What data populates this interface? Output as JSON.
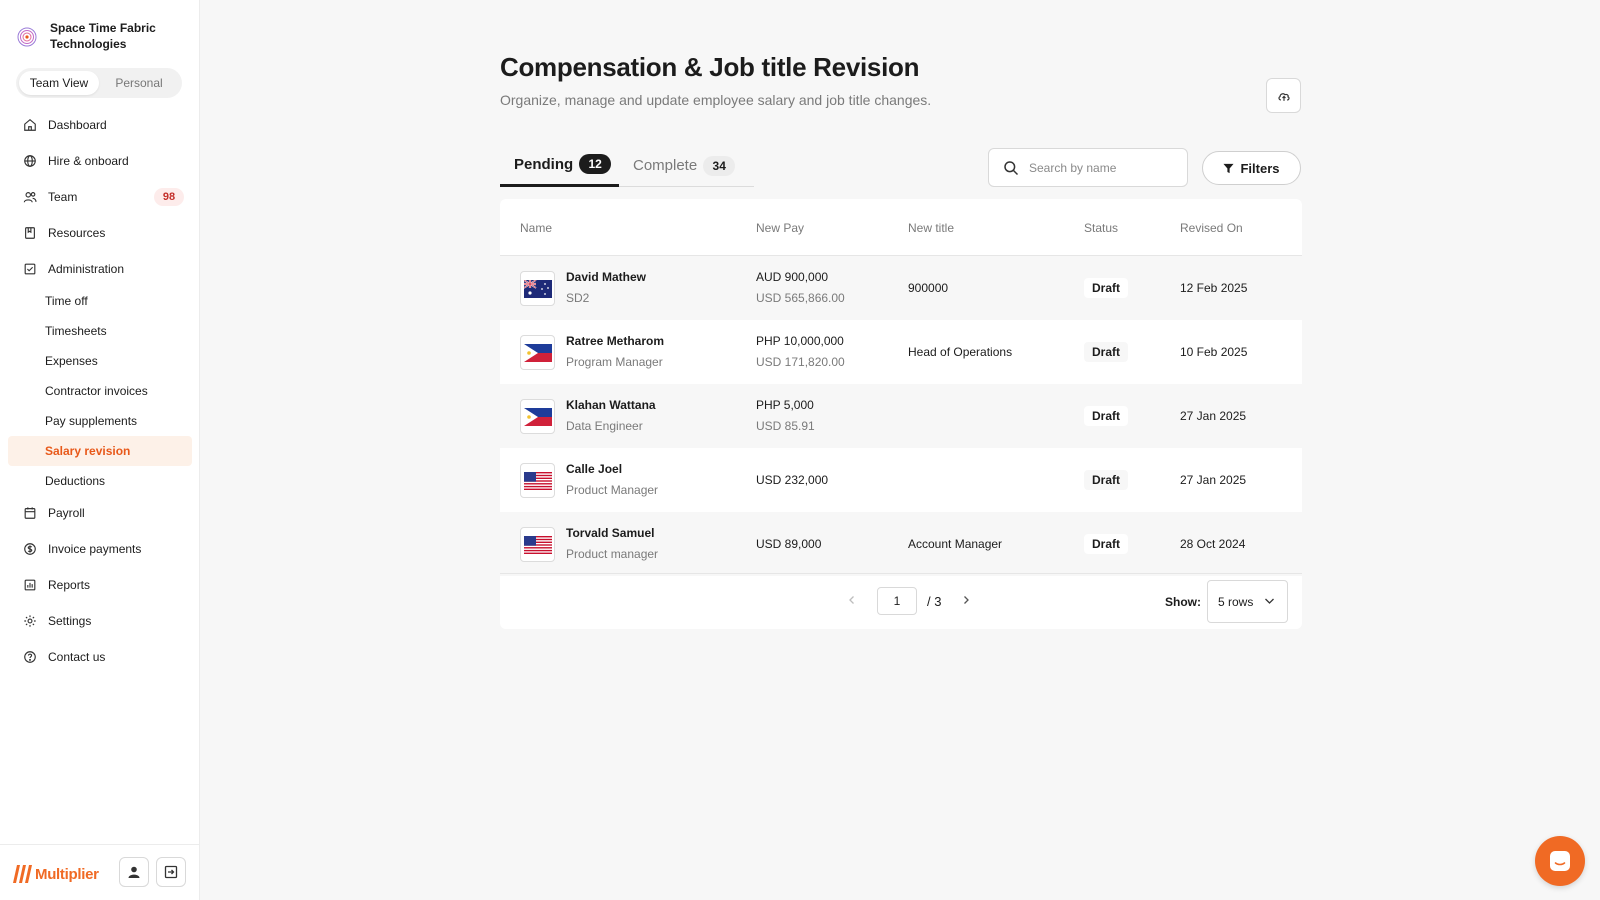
{
  "org": {
    "name": "Space Time Fabric Technologies"
  },
  "view_toggle": {
    "team": "Team View",
    "personal": "Personal"
  },
  "nav": {
    "dashboard": "Dashboard",
    "hire": "Hire & onboard",
    "team": "Team",
    "team_badge": "98",
    "resources": "Resources",
    "administration": "Administration",
    "sub": {
      "time_off": "Time off",
      "timesheets": "Timesheets",
      "expenses": "Expenses",
      "contractor_invoices": "Contractor invoices",
      "pay_supplements": "Pay supplements",
      "salary_revision": "Salary revision",
      "deductions": "Deductions"
    },
    "payroll": "Payroll",
    "invoice_payments": "Invoice payments",
    "reports": "Reports",
    "settings": "Settings",
    "contact": "Contact us"
  },
  "brand": {
    "name": "Multiplier"
  },
  "page": {
    "title": "Compensation & Job title Revision",
    "subtitle": "Organize, manage and update employee salary and job title changes."
  },
  "tabs": {
    "pending": {
      "label": "Pending",
      "count": "12"
    },
    "complete": {
      "label": "Complete",
      "count": "34"
    }
  },
  "search": {
    "placeholder": "Search by name",
    "value": ""
  },
  "filters_label": "Filters",
  "table": {
    "headers": {
      "name": "Name",
      "new_pay": "New Pay",
      "new_title": "New title",
      "status": "Status",
      "revised_on": "Revised On"
    },
    "rows": [
      {
        "name": "David Mathew",
        "role": "SD2",
        "flag": "australia",
        "pay_primary": "AUD 900,000",
        "pay_secondary": "USD 565,866.00",
        "new_title": "900000",
        "status": "Draft",
        "revised_on": "12 Feb 2025"
      },
      {
        "name": "Ratree Metharom",
        "role": "Program Manager",
        "flag": "philippines",
        "pay_primary": "PHP 10,000,000",
        "pay_secondary": "USD 171,820.00",
        "new_title": "Head of Operations",
        "status": "Draft",
        "revised_on": "10 Feb 2025"
      },
      {
        "name": "Klahan Wattana",
        "role": "Data Engineer",
        "flag": "philippines",
        "pay_primary": "PHP 5,000",
        "pay_secondary": "USD 85.91",
        "new_title": "",
        "status": "Draft",
        "revised_on": "27 Jan 2025"
      },
      {
        "name": "Calle Joel",
        "role": "Product Manager",
        "flag": "united-states",
        "pay_primary": "USD 232,000",
        "pay_secondary": "",
        "new_title": "",
        "status": "Draft",
        "revised_on": "27 Jan 2025"
      },
      {
        "name": "Torvald Samuel",
        "role": "Product manager",
        "flag": "united-states",
        "pay_primary": "USD 89,000",
        "pay_secondary": "",
        "new_title": "Account Manager",
        "status": "Draft",
        "revised_on": "28 Oct 2024"
      }
    ]
  },
  "pagination": {
    "current": "1",
    "total": "/ 3",
    "show_label": "Show:",
    "rows_option": "5 rows"
  },
  "colors": {
    "accent": "#f06a24",
    "active_nav_bg": "#fdf1e8",
    "badge_red": "#c4302b"
  }
}
